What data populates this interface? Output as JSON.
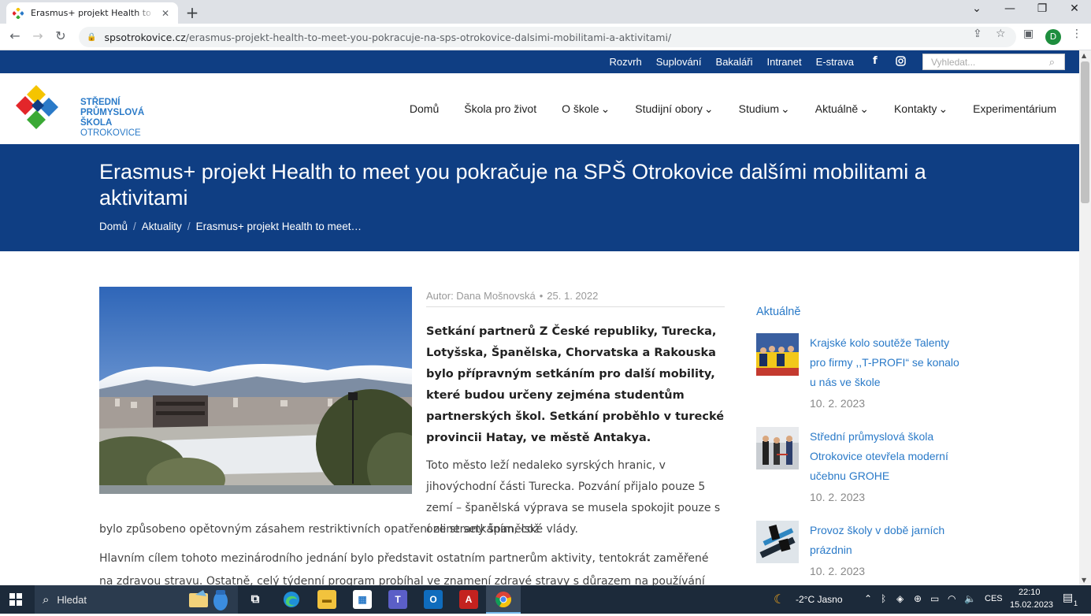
{
  "browser": {
    "tab_title": "Erasmus+ projekt Health to meet you pokračuje na SPŠ Otrokovice dalšími mobilitami a aktivitami",
    "url_domain": "spsotrokovice.cz",
    "url_path": "/erasmus-projekt-health-to-meet-you-pokracuje-na-sps-otrokovice-dalsimi-mobilitami-a-aktivitami/",
    "profile_initial": "D"
  },
  "topbar": {
    "links": [
      "Rozvrh",
      "Suplování",
      "Bakaláři",
      "Intranet",
      "E-strava"
    ],
    "search_placeholder": "Vyhledat..."
  },
  "logo": {
    "line1": "STŘEDNÍ",
    "line2": "PRŮMYSLOVÁ",
    "line3": "ŠKOLA",
    "line4": "OTROKOVICE"
  },
  "mainnav": {
    "items": [
      {
        "label": "Domů",
        "dropdown": false
      },
      {
        "label": "Škola pro život",
        "dropdown": false
      },
      {
        "label": "O škole",
        "dropdown": true
      },
      {
        "label": "Studijní obory",
        "dropdown": true
      },
      {
        "label": "Studium",
        "dropdown": true
      },
      {
        "label": "Aktuálně",
        "dropdown": true
      },
      {
        "label": "Kontakty",
        "dropdown": true
      },
      {
        "label": "Experimentárium",
        "dropdown": false
      }
    ]
  },
  "page": {
    "title": "Erasmus+ projekt Health to meet you pokračuje na SPŠ Otrokovice dalšími mobilitami a aktivitami",
    "breadcrumb": [
      "Domů",
      "Aktuality",
      "Erasmus+ projekt Health to meet…"
    ]
  },
  "article": {
    "author": "Autor: Dana Mošnovská",
    "date": "25. 1. 2022",
    "lead": "Setkání partnerů Z České republiky, Turecka, Lotyšska, Španělska, Chorvatska a Rakouska bylo přípravným setkáním pro další mobility, které budou určeny zejména studentům partnerských škol. Setkání proběhlo v turecké provincii Hatay, ve městě Antakya.",
    "p1_part1": "Toto město leží nedaleko syrských hranic, v jihovýchodní části Turecka. Pozvání přijalo pouze 5 zemí – španělská výprava se musela spokojit pouze s online setkáním, což",
    "p1_part2": "bylo způsobeno opětovným zásahem restriktivních opatření ze strany španělské vlády.",
    "p2": "Hlavním cílem tohoto mezinárodního jednání bylo představit ostatním partnerům aktivity, tentokrát zaměřené na zdravou stravu.  Ostatně, celý týdenní program probíhal ve znamení zdravé stravy s důrazem na používání lokálních a"
  },
  "sidebar": {
    "title": "Aktuálně",
    "news": [
      {
        "title": "Krajské kolo soutěže Talenty pro firmy ,,T-PROFI“ se konalo u nás ve škole",
        "date": "10. 2. 2023"
      },
      {
        "title": "Střední průmyslová škola Otrokovice otevřela moderní učebnu GROHE",
        "date": "10. 2. 2023"
      },
      {
        "title": "Provoz školy v době jarních prázdnin",
        "date": "10. 2. 2023"
      }
    ]
  },
  "taskbar": {
    "search_label": "Hledat",
    "weather": "-2°C  Jasno",
    "lang": "CES",
    "time": "22:10",
    "date": "15.02.2023",
    "notifications": "1"
  },
  "colors": {
    "brand_blue": "#0f3e83",
    "link_blue": "#2a7ac8"
  }
}
